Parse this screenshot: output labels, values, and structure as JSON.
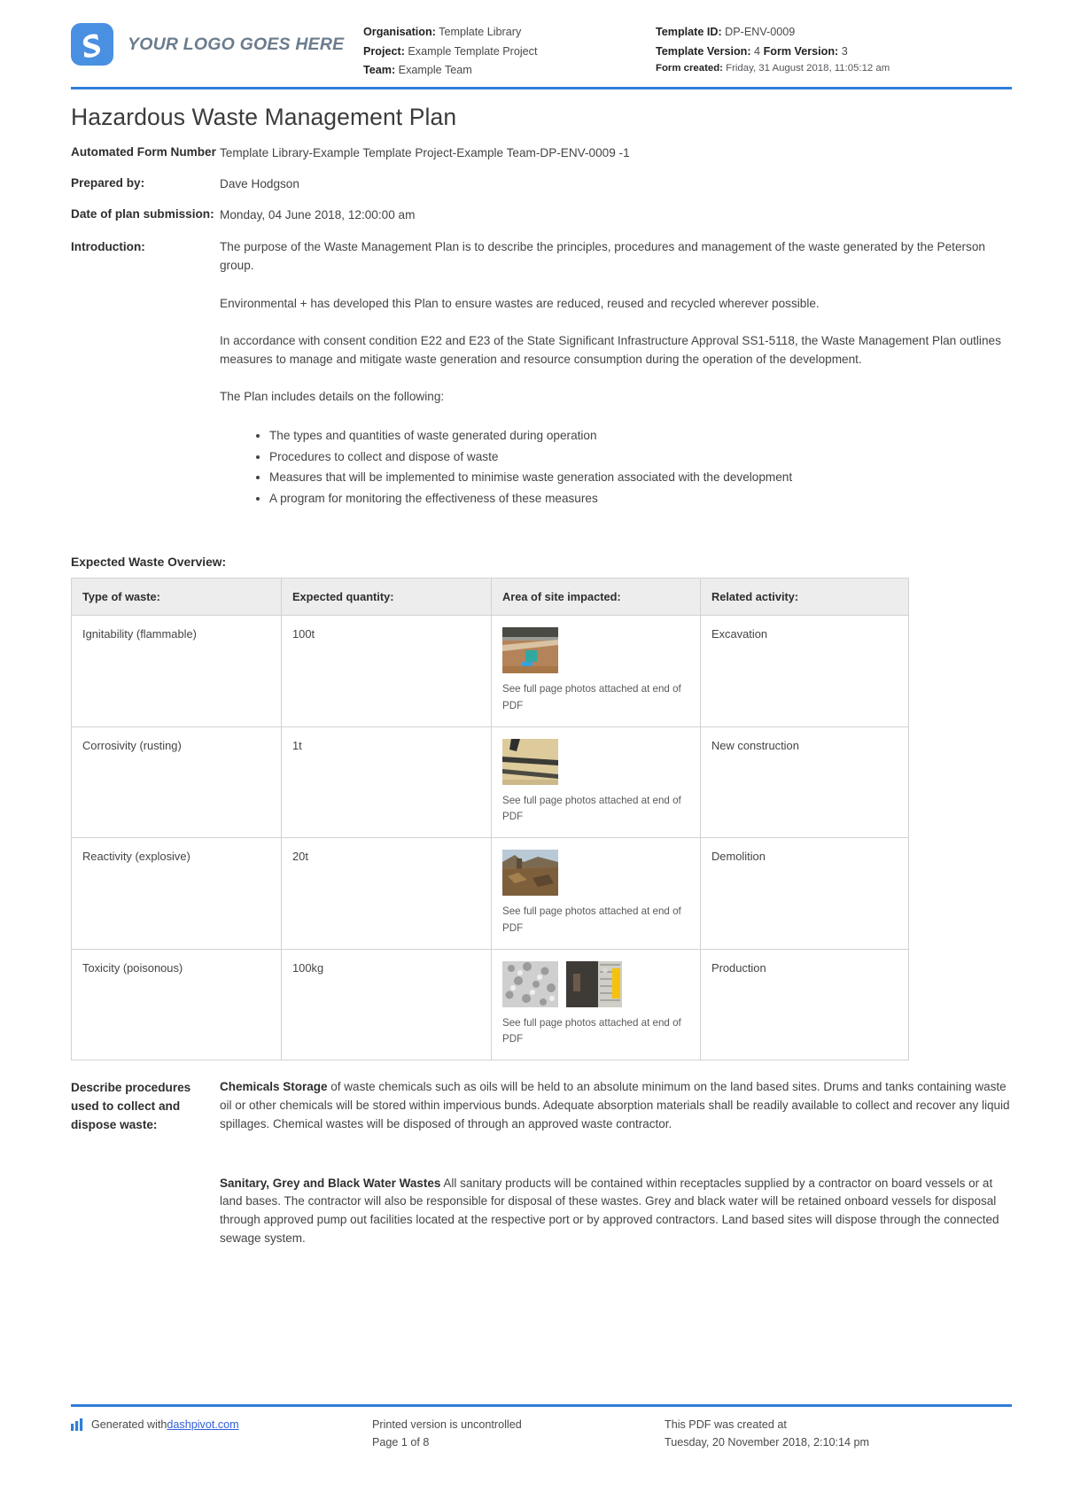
{
  "brand": {
    "logo_text": "YOUR LOGO GOES HERE",
    "accent": "#2f7ed8",
    "logo_bg": "#4a90e2"
  },
  "header": {
    "organisation_label": "Organisation:",
    "organisation_value": "Template Library",
    "project_label": "Project:",
    "project_value": "Example Template Project",
    "team_label": "Team:",
    "team_value": "Example Team",
    "template_id_label": "Template ID:",
    "template_id_value": "DP-ENV-0009",
    "template_version_label": "Template Version:",
    "template_version_value": "4",
    "form_version_label": "Form Version:",
    "form_version_value": "3",
    "form_created_label": "Form created:",
    "form_created_value": "Friday, 31 August 2018, 11:05:12 am"
  },
  "title": "Hazardous Waste Management Plan",
  "fields": {
    "automated_form_number_label": "Automated Form Number",
    "automated_form_number_value": "Template Library-Example Template Project-Example Team-DP-ENV-0009   -1",
    "prepared_by_label": "Prepared by:",
    "prepared_by_value": "Dave Hodgson",
    "date_of_plan_label": "Date of plan submission:",
    "date_of_plan_value": "Monday, 04 June 2018, 12:00:00 am",
    "introduction_label": "Introduction:",
    "introduction_paragraphs": [
      "The purpose of the Waste Management Plan is to describe the principles, procedures and management of the waste generated by the Peterson group.",
      "Environmental + has developed this Plan to ensure wastes are reduced, reused and recycled wherever possible.",
      "In accordance with consent condition E22 and E23 of the State Significant Infrastructure Approval SS1-5118, the Waste Management Plan outlines measures to manage and mitigate waste generation and resource consumption during the operation of the development.",
      "The Plan includes details on the following:"
    ],
    "plan_bullets": [
      "The types and quantities of waste generated during operation",
      "Procedures to collect and dispose of waste",
      "Measures that will be implemented to minimise waste generation associated with the development",
      "A program for monitoring the effectiveness of these measures"
    ]
  },
  "table": {
    "section_title": "Expected Waste Overview:",
    "headers": [
      "Type of waste:",
      "Expected quantity:",
      "Area of site impacted:",
      "Related activity:"
    ],
    "photo_caption": "See full page photos attached at end of PDF",
    "rows": [
      {
        "type": "Ignitability (flammable)",
        "quantity": "100t",
        "photos": 1,
        "activity": "Excavation"
      },
      {
        "type": "Corrosivity (rusting)",
        "quantity": "1t",
        "photos": 1,
        "activity": "New construction"
      },
      {
        "type": "Reactivity (explosive)",
        "quantity": "20t",
        "photos": 1,
        "activity": "Demolition"
      },
      {
        "type": "Toxicity (poisonous)",
        "quantity": "100kg",
        "photos": 2,
        "activity": "Production"
      }
    ]
  },
  "procedures": {
    "label": "Describe procedures used to collect and dispose waste:",
    "paragraph1_bold": "Chemicals Storage",
    "paragraph1_rest": " of waste chemicals such as oils will be held to an absolute minimum on the land based sites. Drums and tanks containing waste oil or other chemicals will be stored within impervious bunds. Adequate absorption materials shall be readily available to collect and recover any liquid spillages. Chemical wastes will be disposed of through an approved waste contractor.",
    "paragraph2_bold": "Sanitary, Grey and Black Water Wastes",
    "paragraph2_rest": " All sanitary products will be contained within receptacles supplied by a contractor on board vessels or at land bases. The contractor will also be responsible for disposal of these wastes. Grey and black water will be retained onboard vessels for disposal through approved pump out facilities located at the respective port or by approved contractors. Land based sites will dispose through the connected sewage system."
  },
  "footer": {
    "generated_prefix": "Generated with ",
    "generated_link": "dashpivot.com",
    "printed_notice": "Printed version is uncontrolled",
    "page_number": "Page 1 of 8",
    "created_label": "This PDF was created at",
    "created_value": "Tuesday, 20 November 2018, 2:10:14 pm"
  }
}
